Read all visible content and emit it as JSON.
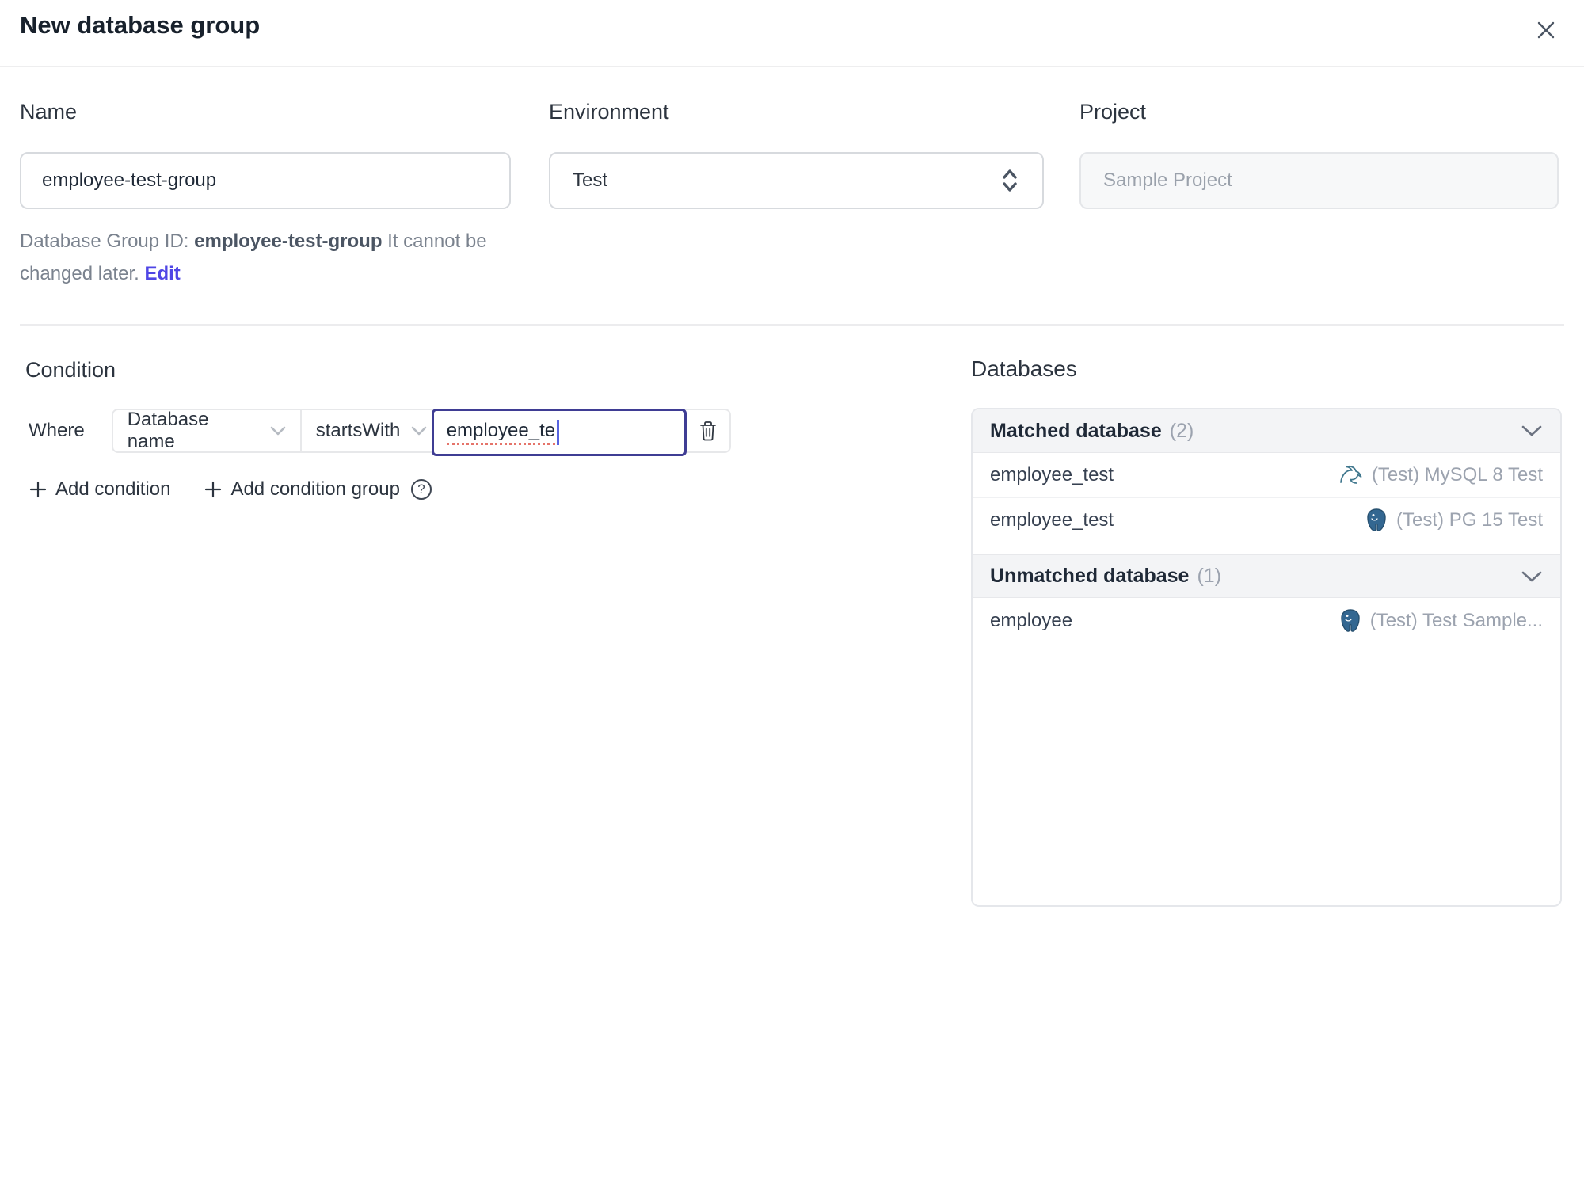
{
  "dialog": {
    "title": "New database group"
  },
  "form": {
    "name": {
      "label": "Name",
      "value": "employee-test-group"
    },
    "environment": {
      "label": "Environment",
      "value": "Test"
    },
    "project": {
      "label": "Project",
      "value": "Sample Project"
    },
    "group_id_note": {
      "prefix": "Database Group ID: ",
      "id": "employee-test-group",
      "suffix": " It cannot be changed later. ",
      "edit_label": "Edit"
    }
  },
  "condition": {
    "title": "Condition",
    "where_label": "Where",
    "factor": "Database name",
    "operator": "startsWith",
    "value": "employee_te",
    "add_condition_label": "Add condition",
    "add_condition_group_label": "Add condition group",
    "help_glyph": "?"
  },
  "databases": {
    "title": "Databases",
    "sections": [
      {
        "label": "Matched database",
        "count": "(2)",
        "rows": [
          {
            "name": "employee_test",
            "engine": "mysql-icon",
            "instance": "(Test) MySQL 8 Test"
          },
          {
            "name": "employee_test",
            "engine": "postgres-icon",
            "instance": "(Test) PG 15 Test"
          }
        ]
      },
      {
        "label": "Unmatched database",
        "count": "(1)",
        "rows": [
          {
            "name": "employee",
            "engine": "postgres-icon",
            "instance": "(Test) Test Sample..."
          }
        ]
      }
    ]
  },
  "colors": {
    "accent": "#4f46e5",
    "focus_border": "#3f3d94",
    "header_bg": "#f3f4f6",
    "muted_text": "#9ca3af",
    "mysql_icon": "#41788e",
    "postgres_icon": "#336791",
    "spellcheck_underline": "#e5746a"
  }
}
